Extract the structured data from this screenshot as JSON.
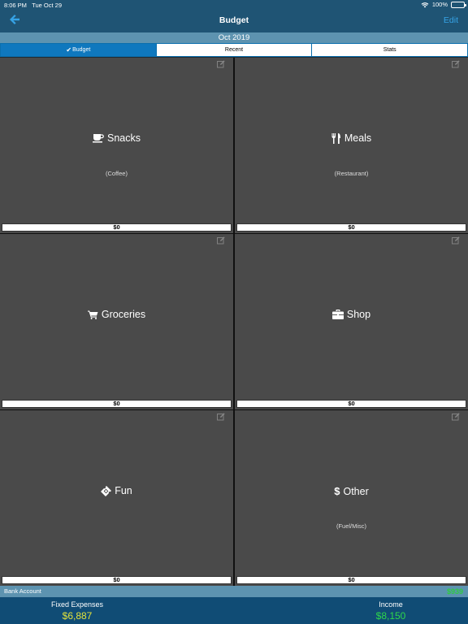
{
  "status": {
    "time": "8:06 PM",
    "date": "Tue Oct 29",
    "battery": "100%"
  },
  "nav": {
    "title": "Budget",
    "edit_label": "Edit"
  },
  "month": "Oct 2019",
  "tabs": [
    {
      "label": "Budget",
      "active": true
    },
    {
      "label": "Recent",
      "active": false
    },
    {
      "label": "Stats",
      "active": false
    }
  ],
  "categories": [
    {
      "name": "Snacks",
      "sub": "(Coffee)",
      "amount": "$0",
      "icon": "coffee-cup-icon"
    },
    {
      "name": "Meals",
      "sub": "(Restaurant)",
      "amount": "$0",
      "icon": "fork-knife-icon"
    },
    {
      "name": "Groceries",
      "sub": "",
      "amount": "$0",
      "icon": "shopping-cart-icon"
    },
    {
      "name": "Shop",
      "sub": "",
      "amount": "$0",
      "icon": "briefcase-icon"
    },
    {
      "name": "Fun",
      "sub": "",
      "amount": "$0",
      "icon": "ticket-icon"
    },
    {
      "name": "Other",
      "sub": "(Fuel/Misc)",
      "amount": "$0",
      "icon": "dollar-icon"
    }
  ],
  "bank": {
    "label": "Bank Account",
    "value": "$939"
  },
  "footer": {
    "fixed_label": "Fixed Expenses",
    "fixed_value": "$6,887",
    "income_label": "Income",
    "income_value": "$8,150"
  },
  "colors": {
    "nav": "#1f5474",
    "accent": "#36a3e6",
    "tile": "#4a4a4a",
    "positive": "#2ed84a",
    "fixed": "#e3e23a"
  }
}
